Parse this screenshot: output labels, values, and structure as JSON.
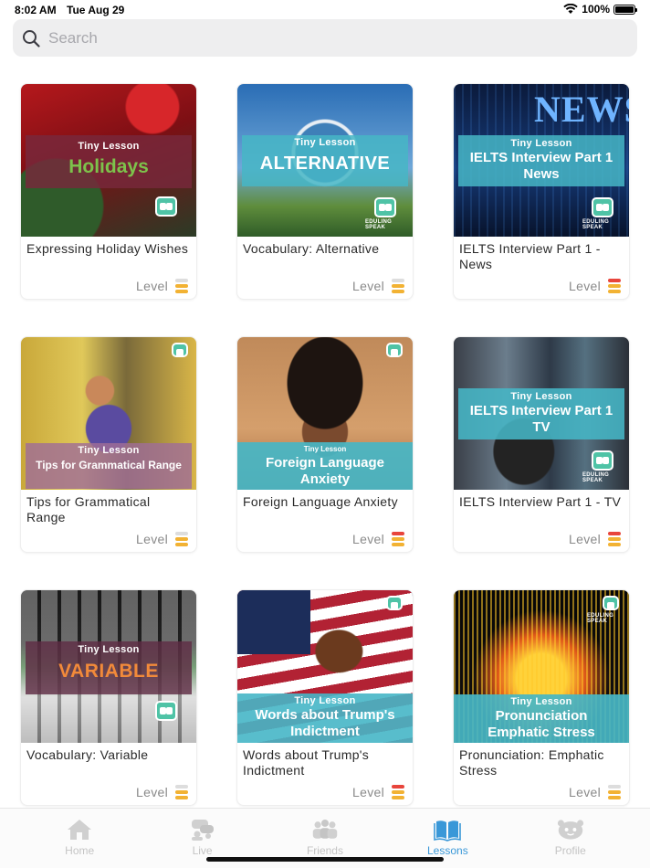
{
  "status_bar": {
    "time": "8:02 AM",
    "date": "Tue Aug 29",
    "battery": "100%"
  },
  "search": {
    "placeholder": "Search"
  },
  "lessons": [
    {
      "title": "Expressing Holiday Wishes",
      "tiny": "Tiny Lesson",
      "overlay": "Holidays",
      "level_colors": [
        "#dddddd",
        "#f2b233",
        "#f2b233"
      ]
    },
    {
      "title": "Vocabulary: Alternative",
      "tiny": "Tiny Lesson",
      "overlay": "ALTERNATIVE",
      "logo_text": "EDULING SPEAK",
      "level_colors": [
        "#dddddd",
        "#f2b233",
        "#f2b233"
      ]
    },
    {
      "title": "IELTS Interview Part 1 - News",
      "tiny": "Tiny Lesson",
      "overlay": "IELTS Interview Part 1 News",
      "bg_text": "NEWS",
      "logo_text": "EDULING SPEAK",
      "level_colors": [
        "#e8453c",
        "#f2b233",
        "#f2b233"
      ]
    },
    {
      "title": "Tips for Grammatical Range",
      "tiny": "Tiny Lesson",
      "overlay": "Tips for Grammatical Range",
      "level_colors": [
        "#dddddd",
        "#f2b233",
        "#f2b233"
      ]
    },
    {
      "title": "Foreign Language Anxiety",
      "tiny": "Tiny Lesson",
      "overlay": "Foreign Language Anxiety",
      "level_colors": [
        "#e8453c",
        "#f2b233",
        "#f2b233"
      ]
    },
    {
      "title": "IELTS Interview Part 1 - TV",
      "tiny": "Tiny Lesson",
      "overlay": "IELTS Interview Part 1 TV",
      "logo_text": "EDULING SPEAK",
      "level_colors": [
        "#e8453c",
        "#f2b233",
        "#f2b233"
      ]
    },
    {
      "title": "Vocabulary: Variable",
      "tiny": "Tiny Lesson",
      "overlay": "VARIABLE",
      "level_colors": [
        "#dddddd",
        "#f2b233",
        "#f2b233"
      ]
    },
    {
      "title": "Words about Trump's Indictment",
      "tiny": "Tiny Lesson",
      "overlay": "Words about Trump's Indictment",
      "level_colors": [
        "#e8453c",
        "#f2b233",
        "#f2b233"
      ]
    },
    {
      "title": "Pronunciation: Emphatic Stress",
      "tiny": "Tiny Lesson",
      "overlay": "Pronunciation Emphatic Stress",
      "logo_text": "EDULING SPEAK",
      "level_colors": [
        "#dddddd",
        "#f2b233",
        "#f2b233"
      ]
    }
  ],
  "level_label": "Level",
  "tabs": [
    {
      "label": "Home",
      "icon": "house-icon",
      "active": false
    },
    {
      "label": "Live",
      "icon": "live-icon",
      "active": false
    },
    {
      "label": "Friends",
      "icon": "friends-icon",
      "active": false
    },
    {
      "label": "Lessons",
      "icon": "book-icon",
      "active": true
    },
    {
      "label": "Profile",
      "icon": "profile-face-icon",
      "active": false
    }
  ],
  "colors": {
    "accent": "#3a98d8",
    "level_high": "#e8453c",
    "level_mid": "#f2b233",
    "level_empty": "#dddddd",
    "teal_overlay": "#46b6c6"
  }
}
